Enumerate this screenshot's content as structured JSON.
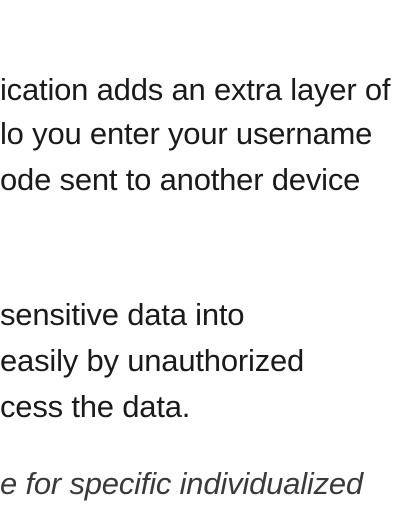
{
  "paragraph_2fa": {
    "lines": [
      "ication adds an extra layer of",
      "lo you enter your username",
      "ode sent to another device"
    ]
  },
  "paragraph_encryption": {
    "lines": [
      " sensitive data into",
      "easily by unauthorized",
      "cess the data."
    ]
  },
  "footer_note": {
    "text": "e for specific individualized"
  }
}
